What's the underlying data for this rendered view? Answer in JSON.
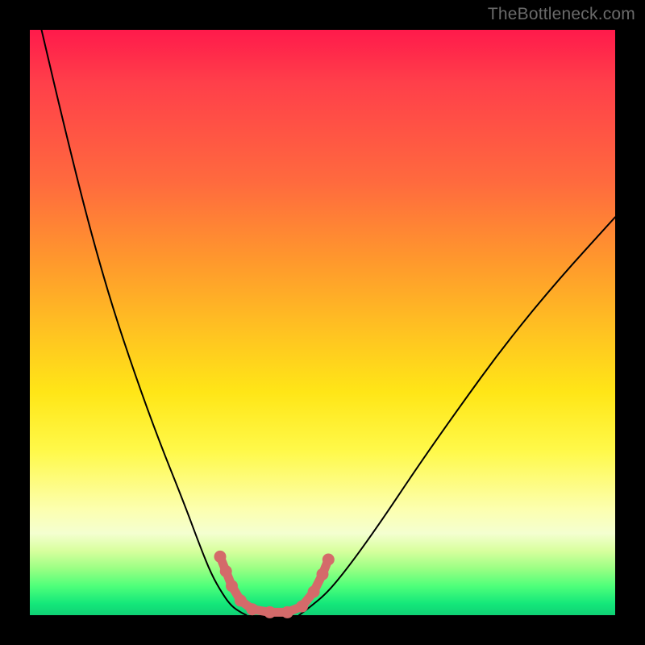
{
  "watermark": "TheBottleneck.com",
  "chart_data": {
    "type": "line",
    "title": "",
    "xlabel": "",
    "ylabel": "",
    "xlim": [
      0,
      100
    ],
    "ylim": [
      0,
      100
    ],
    "grid": false,
    "legend": false,
    "note": "Axes are unlabeled; values are normalized 0–100 estimated from pixel positions. y=0 is bottom (green, optimal), y=100 is top (red, worst).",
    "series": [
      {
        "name": "left-curve",
        "x": [
          2,
          6,
          10,
          14,
          18,
          22,
          26,
          29,
          31,
          33,
          34.5,
          36,
          37
        ],
        "y": [
          100,
          83,
          67,
          53,
          41,
          30,
          20,
          12,
          7,
          3.5,
          1.5,
          0.5,
          0
        ]
      },
      {
        "name": "trough",
        "x": [
          37,
          40,
          43,
          46
        ],
        "y": [
          0,
          0,
          0,
          0
        ]
      },
      {
        "name": "right-curve",
        "x": [
          46,
          48,
          51,
          55,
          60,
          66,
          73,
          81,
          90,
          100
        ],
        "y": [
          0,
          1.5,
          4,
          9,
          16,
          25,
          35,
          46,
          57,
          68
        ]
      }
    ],
    "highlight_points": {
      "name": "trough-markers",
      "color": "#d46a6a",
      "points": [
        {
          "x": 32.5,
          "y": 10
        },
        {
          "x": 33.5,
          "y": 7.5
        },
        {
          "x": 34.5,
          "y": 5
        },
        {
          "x": 36,
          "y": 2.5
        },
        {
          "x": 38,
          "y": 1
        },
        {
          "x": 41,
          "y": 0.5
        },
        {
          "x": 44,
          "y": 0.5
        },
        {
          "x": 46.5,
          "y": 1.5
        },
        {
          "x": 48.5,
          "y": 4
        },
        {
          "x": 50,
          "y": 7
        },
        {
          "x": 51,
          "y": 9.5
        }
      ]
    },
    "background_gradient": {
      "orientation": "vertical",
      "stops": [
        {
          "pos": 0,
          "color": "#ff1a4b"
        },
        {
          "pos": 40,
          "color": "#ff9a2c"
        },
        {
          "pos": 72,
          "color": "#fff94a"
        },
        {
          "pos": 100,
          "color": "#0fd074"
        }
      ]
    }
  }
}
